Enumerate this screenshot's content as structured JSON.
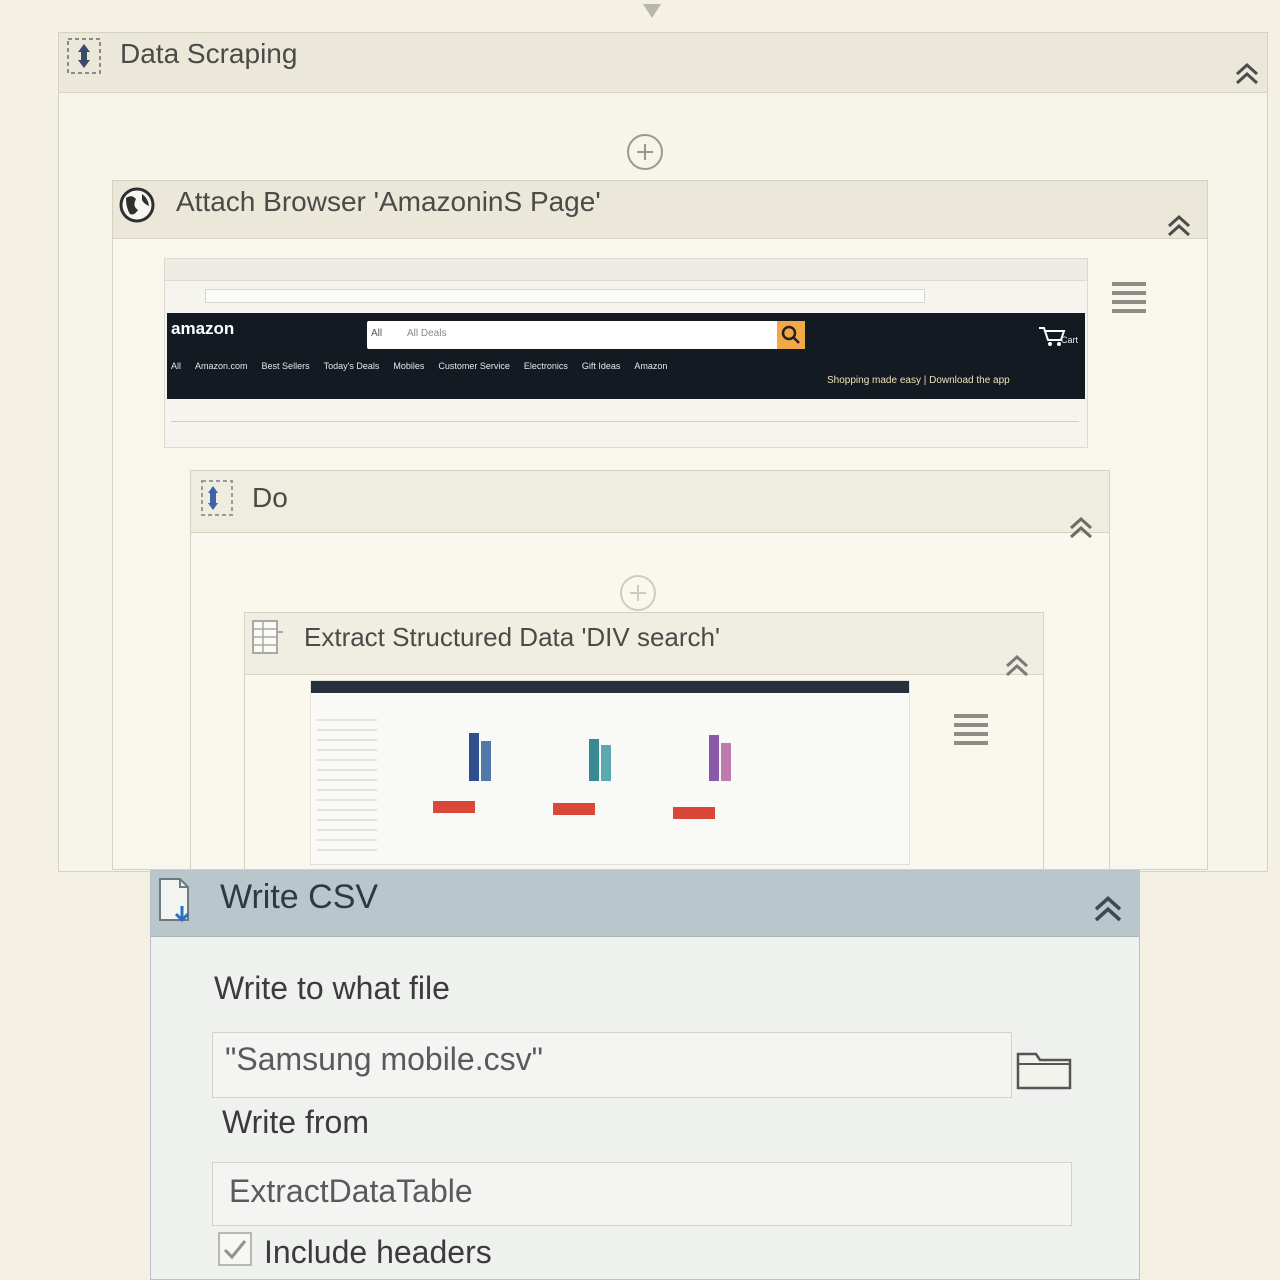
{
  "workflow": {
    "data_scraping": {
      "title": "Data Scraping"
    },
    "attach_browser": {
      "title": "Attach Browser 'AmazoninS Page'",
      "preview": {
        "logo": "amazon",
        "search_category": "All",
        "search_placeholder": "All Deals",
        "nav": [
          "All",
          "Amazon.com",
          "Best Sellers",
          "Today's Deals",
          "Mobiles",
          "Customer Service",
          "Electronics",
          "Gift Ideas",
          "Amazon"
        ],
        "promo": "Shopping made easy | Download the app",
        "cart": "Cart"
      }
    },
    "do": {
      "title": "Do"
    },
    "extract": {
      "title": "Extract Structured Data 'DIV  search'"
    },
    "write_csv": {
      "title": "Write CSV",
      "file_label": "Write to what file",
      "file_value": "\"Samsung mobile.csv\"",
      "from_label": "Write from",
      "from_value": "ExtractDataTable",
      "headers_label": "Include headers",
      "headers_checked": true
    }
  },
  "colors": {
    "amazon_bar": "#131a22",
    "amazon_accent": "#f3a847",
    "csv_header": "#b9c7cd"
  }
}
